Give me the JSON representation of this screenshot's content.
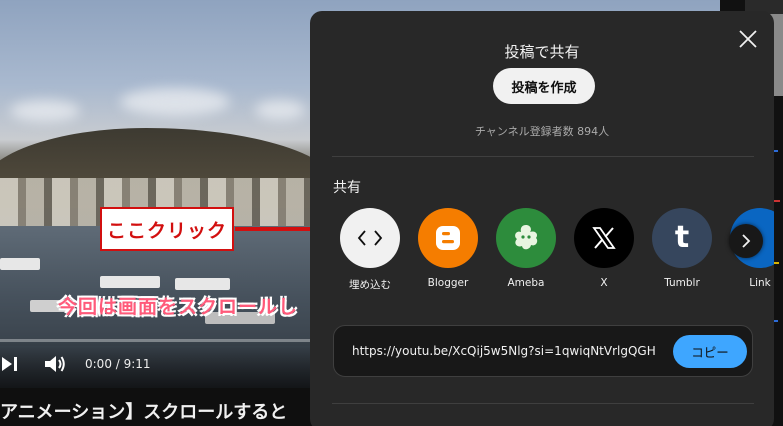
{
  "video": {
    "subtitle": "今回は画面をスクロールし",
    "time": "0:00 / 9:11",
    "title": "アニメーション】スクロールすると"
  },
  "annotation": {
    "label": "ここクリック"
  },
  "dialog": {
    "title": "投稿で共有",
    "create_post_label": "投稿を作成",
    "subscribers": "チャンネル登録者数 894人",
    "share_heading": "共有",
    "share_targets": [
      {
        "name": "埋め込む",
        "icon": "embed-icon",
        "color": "#f1f1f1"
      },
      {
        "name": "Blogger",
        "icon": "blogger-icon",
        "color": "#f57d00"
      },
      {
        "name": "Ameba",
        "icon": "ameba-icon",
        "color": "#2d8c3c"
      },
      {
        "name": "X",
        "icon": "x-icon",
        "color": "#000000"
      },
      {
        "name": "Tumblr",
        "icon": "tumblr-icon",
        "color": "#36465d"
      },
      {
        "name": "Link",
        "icon": "linkedin-icon",
        "color": "#0a66c2"
      }
    ],
    "url": "https://youtu.be/XcQij5w5Nlg?si=1qwiqNtVrlgQGH",
    "copy_label": "コピー"
  },
  "colors": {
    "dialog_bg": "#282828",
    "accent": "#3ea6ff",
    "annotation": "#d20f0f"
  }
}
